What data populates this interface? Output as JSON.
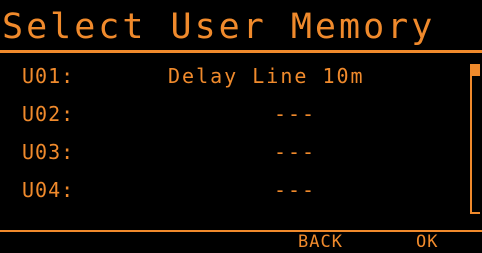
{
  "screen": {
    "title": "Select User Memory"
  },
  "memory_list": {
    "items": [
      {
        "slot": "U01:",
        "name": "Delay Line 10m"
      },
      {
        "slot": "U02:",
        "name": "---"
      },
      {
        "slot": "U03:",
        "name": "---"
      },
      {
        "slot": "U04:",
        "name": "---"
      }
    ]
  },
  "softkeys": {
    "back_label": "BACK",
    "ok_label": "OK"
  },
  "theme": {
    "foreground": "#f08a2c",
    "background": "#000000"
  }
}
